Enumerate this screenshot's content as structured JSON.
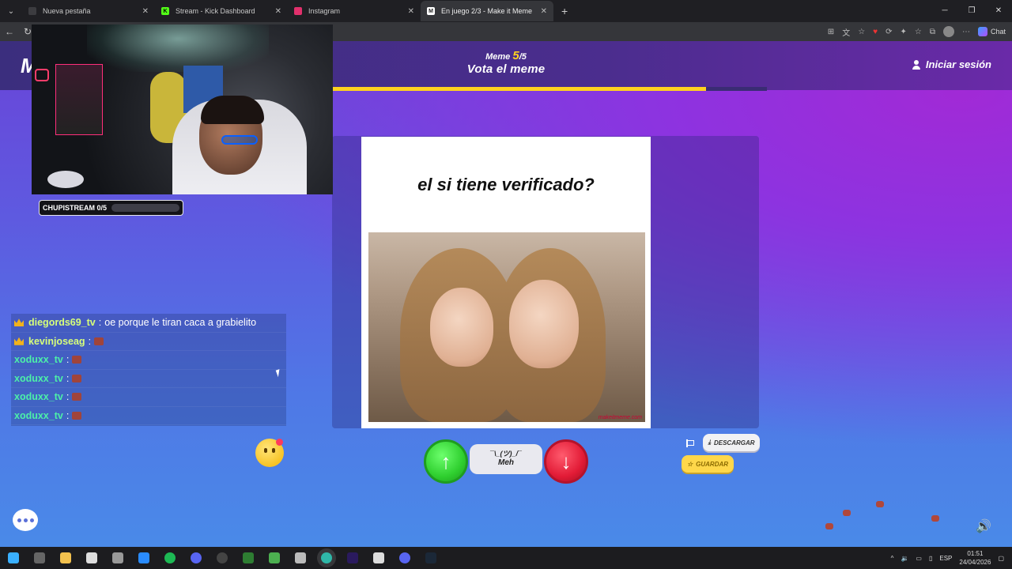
{
  "browser": {
    "tabs": [
      {
        "label": "Nueva pestaña",
        "fav_color": "#3c3c40",
        "active": false
      },
      {
        "label": "Stream - Kick Dashboard",
        "fav_color": "#53fc18",
        "active": false
      },
      {
        "label": "Instagram",
        "fav_color": "#e1306c",
        "active": false
      },
      {
        "label": "En juego 2/3 - Make it Meme",
        "fav_color": "#ffffff",
        "active": true
      }
    ],
    "chat_label": "Chat"
  },
  "game": {
    "logo": "M",
    "meme_label": "Meme",
    "meme_current": "5",
    "meme_total": "/5",
    "title": "Vota el meme",
    "progress": 0.86,
    "login_label": "Iniciar sesión",
    "meme_caption": "el si tiene verificado?",
    "watermark": "makeitmeme.com",
    "meh_face": "¯\\_(ツ)_/¯",
    "meh_label": "Meh",
    "download_label": "DESCARGAR",
    "save_label": "GUARDAR"
  },
  "stream": {
    "goal_label": "CHUPISTREAM 0/5",
    "goal_progress": 0,
    "chat": [
      {
        "user": "diegords69_tv",
        "message": "oe porque le tiran caca a grabielito",
        "badge": true,
        "color": "#d7ff7a"
      },
      {
        "user": "kevinjoseag",
        "message": "",
        "badge": true,
        "color": "#d7ff7a",
        "emote": true
      },
      {
        "user": "xoduxx_tv",
        "message": "",
        "badge": false,
        "color": "#4cf0a8",
        "emote": true
      },
      {
        "user": "xoduxx_tv",
        "message": "",
        "badge": false,
        "color": "#4cf0a8",
        "emote": true
      },
      {
        "user": "xoduxx_tv",
        "message": "",
        "badge": false,
        "color": "#4cf0a8",
        "emote": true
      },
      {
        "user": "xoduxx_tv",
        "message": "",
        "badge": false,
        "color": "#4cf0a8",
        "emote": true
      }
    ]
  },
  "taskbar": {
    "lang": "ESP",
    "time": "01:51",
    "date": "24/04/2026"
  }
}
